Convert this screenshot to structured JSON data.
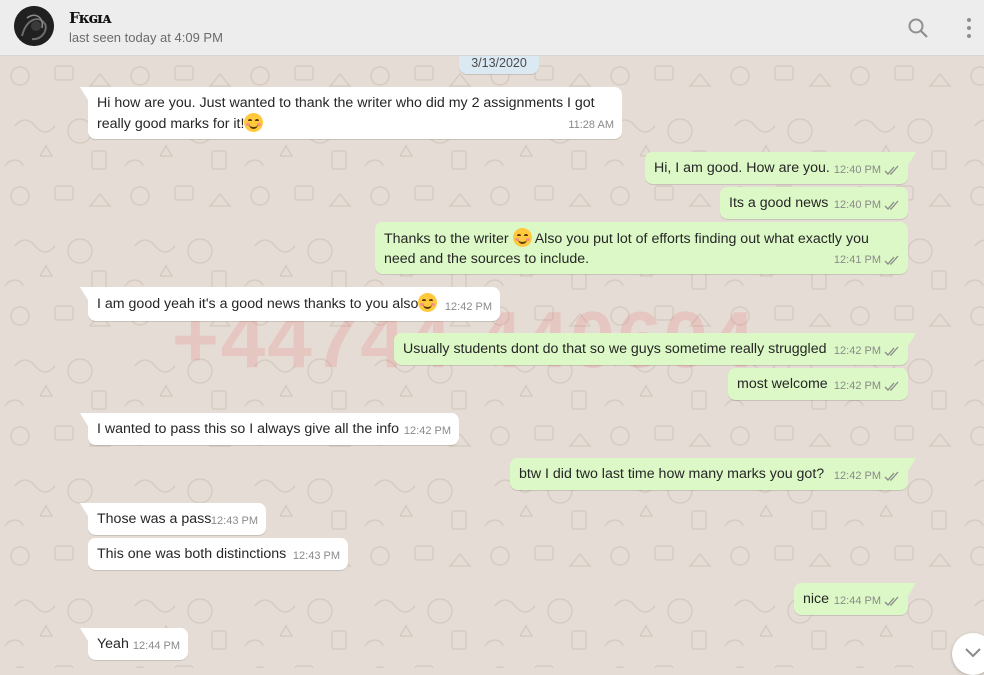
{
  "header": {
    "contact_name": "Fᴋɢɪᴀ",
    "last_seen": "last seen today at 4:09 PM",
    "search_icon": "search-icon",
    "menu_icon": "kebab-menu-icon"
  },
  "chat": {
    "date_label": "3/13/2020",
    "watermark": "+44744 440604",
    "messages": [
      {
        "dir": "in",
        "text": "Hi how are you. Just wanted to thank the writer who did my 2 assignments I got really good marks for it!",
        "emoji": "smiling-face-emoji",
        "time": "11:28 AM"
      },
      {
        "dir": "out",
        "text": "Hi, I am good. How are you.",
        "time": "12:40 PM",
        "status": "read"
      },
      {
        "dir": "out",
        "text": "Its a good news",
        "time": "12:40 PM",
        "status": "read"
      },
      {
        "dir": "out",
        "text_a": "Thanks to the writer",
        "text_b": "Also you put lot of efforts finding out what exactly you need and the sources to include.",
        "emoji": "smiling-face-emoji",
        "time": "12:41 PM",
        "status": "read"
      },
      {
        "dir": "in",
        "text": "I am good yeah it's a good news thanks to you also",
        "emoji": "smiling-face-emoji",
        "time": "12:42 PM"
      },
      {
        "dir": "out",
        "text": "Usually students dont do that so we guys sometime really struggled",
        "time": "12:42 PM",
        "status": "read"
      },
      {
        "dir": "out",
        "text": "most welcome",
        "time": "12:42 PM",
        "status": "read"
      },
      {
        "dir": "in",
        "text": "I wanted to pass this so I always give all the info",
        "time": "12:42 PM"
      },
      {
        "dir": "out",
        "text": "btw I did two last time how many marks you got?",
        "time": "12:42 PM",
        "status": "read"
      },
      {
        "dir": "in",
        "text": "Those was a pass",
        "time": "12:43 PM"
      },
      {
        "dir": "in",
        "text": "This one was both distinctions",
        "time": "12:43 PM"
      },
      {
        "dir": "out",
        "text": "nice",
        "time": "12:44 PM",
        "status": "read"
      },
      {
        "dir": "in",
        "text": "Yeah",
        "time": "12:44 PM"
      }
    ]
  },
  "colors": {
    "incoming_bubble": "#ffffff",
    "outgoing_bubble": "#dcf8c6",
    "read_ticks": "#8a8a8a",
    "chat_background": "#e5ddd5"
  }
}
